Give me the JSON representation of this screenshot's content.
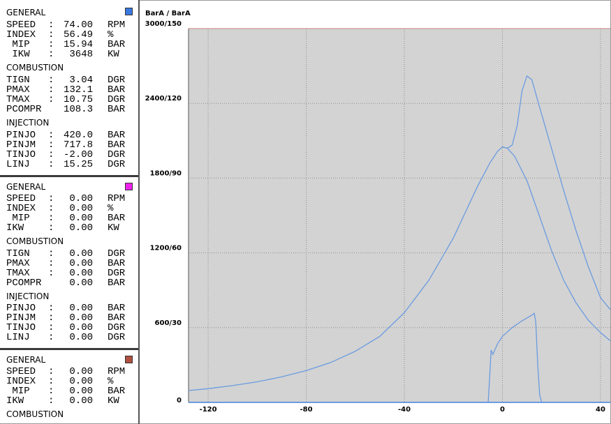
{
  "panels": [
    {
      "color": "#3a78e0",
      "sections": [
        {
          "title": "GENERAL",
          "rows": [
            {
              "name": "SPEED",
              "colon": ":",
              "value": "74.00",
              "unit": "RPM"
            },
            {
              "name": "INDEX",
              "colon": ":",
              "value": "56.49",
              "unit": "%"
            },
            {
              "name": " MIP",
              "colon": ":",
              "value": "15.94",
              "unit": "BAR"
            },
            {
              "name": " IKW",
              "colon": ":",
              "value": "3648",
              "unit": "KW"
            }
          ]
        },
        {
          "title": "COMBUSTION",
          "rows": [
            {
              "name": "TIGN",
              "colon": ":",
              "value": "3.04",
              "unit": "DGR"
            },
            {
              "name": "PMAX",
              "colon": ":",
              "value": "132.1",
              "unit": "BAR"
            },
            {
              "name": "TMAX",
              "colon": ":",
              "value": "10.75",
              "unit": "DGR"
            },
            {
              "name": "PCOMPR",
              "colon": "",
              "value": "108.3",
              "unit": "BAR"
            }
          ]
        },
        {
          "title": "INJECTION",
          "rows": [
            {
              "name": "PINJO",
              "colon": ":",
              "value": "420.0",
              "unit": "BAR"
            },
            {
              "name": "PINJM",
              "colon": ":",
              "value": "717.8",
              "unit": "BAR"
            },
            {
              "name": "TINJO",
              "colon": ":",
              "value": "-2.00",
              "unit": "DGR"
            },
            {
              "name": "LINJ",
              "colon": ":",
              "value": "15.25",
              "unit": "DGR"
            }
          ]
        }
      ]
    },
    {
      "color": "#ee22ee",
      "sections": [
        {
          "title": "GENERAL",
          "rows": [
            {
              "name": "SPEED",
              "colon": ":",
              "value": "0.00",
              "unit": "RPM"
            },
            {
              "name": "INDEX",
              "colon": ":",
              "value": "0.00",
              "unit": "%"
            },
            {
              "name": " MIP",
              "colon": ":",
              "value": "0.00",
              "unit": "BAR"
            },
            {
              "name": "IKW",
              "colon": ":",
              "value": "0.00",
              "unit": "KW"
            }
          ]
        },
        {
          "title": "COMBUSTION",
          "rows": [
            {
              "name": "TIGN",
              "colon": ":",
              "value": "0.00",
              "unit": "DGR"
            },
            {
              "name": "PMAX",
              "colon": ":",
              "value": "0.00",
              "unit": "BAR"
            },
            {
              "name": "TMAX",
              "colon": ":",
              "value": "0.00",
              "unit": "DGR"
            },
            {
              "name": "PCOMPR",
              "colon": "",
              "value": "0.00",
              "unit": "BAR"
            }
          ]
        },
        {
          "title": "INJECTION",
          "rows": [
            {
              "name": "PINJO",
              "colon": ":",
              "value": "0.00",
              "unit": "BAR"
            },
            {
              "name": "PINJM",
              "colon": ":",
              "value": "0.00",
              "unit": "BAR"
            },
            {
              "name": "TINJO",
              "colon": ":",
              "value": "0.00",
              "unit": "DGR"
            },
            {
              "name": "LINJ",
              "colon": ":",
              "value": "0.00",
              "unit": "DGR"
            }
          ]
        }
      ]
    },
    {
      "color": "#b05040",
      "sections": [
        {
          "title": "GENERAL",
          "rows": [
            {
              "name": "SPEED",
              "colon": ":",
              "value": "0.00",
              "unit": "RPM"
            },
            {
              "name": "INDEX",
              "colon": ":",
              "value": "0.00",
              "unit": "%"
            },
            {
              "name": " MIP",
              "colon": ":",
              "value": "0.00",
              "unit": "BAR"
            },
            {
              "name": "IKW",
              "colon": ":",
              "value": "0.00",
              "unit": "KW"
            }
          ]
        },
        {
          "title": "COMBUSTION",
          "rows": []
        }
      ]
    }
  ],
  "chart_data": {
    "type": "line",
    "ylabel": "BarA / BarA",
    "xlim": [
      -128,
      44
    ],
    "ylim": [
      0,
      3000
    ],
    "x_ticks": [
      "-120",
      "-80",
      "-40",
      "0",
      "40"
    ],
    "x_tick_values": [
      -120,
      -80,
      -40,
      0,
      40
    ],
    "y_ticks": [
      "0",
      "600/30",
      "1200/60",
      "1800/90",
      "2400/120",
      "3000/150"
    ],
    "y_tick_values": [
      0,
      600,
      1200,
      1800,
      2400,
      3000
    ],
    "grid": true,
    "background": "#d3d3d3",
    "line_color": "#6a9be0",
    "series": [
      {
        "points": [
          [
            -128,
            95
          ],
          [
            -120,
            110
          ],
          [
            -110,
            135
          ],
          [
            -100,
            165
          ],
          [
            -90,
            205
          ],
          [
            -80,
            255
          ],
          [
            -70,
            320
          ],
          [
            -60,
            410
          ],
          [
            -50,
            530
          ],
          [
            -40,
            720
          ],
          [
            -30,
            980
          ],
          [
            -20,
            1320
          ],
          [
            -15,
            1530
          ],
          [
            -10,
            1740
          ],
          [
            -5,
            1925
          ],
          [
            -2,
            2015
          ],
          [
            0,
            2050
          ],
          [
            2,
            2040
          ],
          [
            4,
            2065
          ],
          [
            6,
            2220
          ],
          [
            8,
            2500
          ],
          [
            10,
            2620
          ],
          [
            12,
            2590
          ],
          [
            15,
            2380
          ],
          [
            20,
            2040
          ],
          [
            25,
            1700
          ],
          [
            30,
            1380
          ],
          [
            35,
            1090
          ],
          [
            40,
            840
          ],
          [
            44,
            745
          ]
        ]
      },
      {
        "points": [
          [
            0,
            2050
          ],
          [
            2,
            2040
          ],
          [
            5,
            1975
          ],
          [
            10,
            1780
          ],
          [
            15,
            1500
          ],
          [
            20,
            1220
          ],
          [
            25,
            980
          ],
          [
            30,
            800
          ],
          [
            35,
            660
          ],
          [
            40,
            560
          ],
          [
            44,
            495
          ]
        ]
      },
      {
        "points": [
          [
            -5.8,
            0
          ],
          [
            -5.2,
            200
          ],
          [
            -4.6,
            420
          ],
          [
            -3.9,
            385
          ],
          [
            -2,
            470
          ],
          [
            0,
            530
          ],
          [
            4,
            600
          ],
          [
            8,
            655
          ],
          [
            12,
            700
          ],
          [
            13,
            715
          ],
          [
            13.6,
            650
          ],
          [
            14.4,
            300
          ],
          [
            15.2,
            60
          ],
          [
            16,
            0
          ]
        ]
      }
    ]
  }
}
